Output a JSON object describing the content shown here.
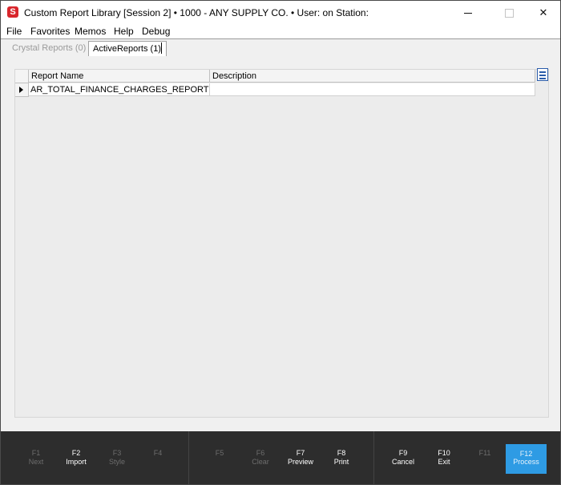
{
  "window": {
    "icon_letter": "S",
    "title": "Custom Report Library [Session 2]  •  1000 - ANY SUPPLY CO.  •  User:              on Station:"
  },
  "menu": [
    "File",
    "Favorites",
    "Memos",
    "Help",
    "Debug"
  ],
  "tabs": [
    {
      "label": "Crystal Reports (0)",
      "active": false
    },
    {
      "label": "ActiveReports (1)",
      "active": true
    }
  ],
  "grid": {
    "columns": [
      "Report Name",
      "Description"
    ],
    "rows": [
      {
        "name": "AR_TOTAL_FINANCE_CHARGES_REPORT",
        "description": ""
      }
    ]
  },
  "function_keys": [
    {
      "key": "F1",
      "label": "Next",
      "enabled": false
    },
    {
      "key": "F2",
      "label": "Import",
      "enabled": true
    },
    {
      "key": "F3",
      "label": "Style",
      "enabled": false
    },
    {
      "key": "F4",
      "label": "",
      "enabled": false
    },
    {
      "key": "F5",
      "label": "",
      "enabled": false
    },
    {
      "key": "F6",
      "label": "Clear",
      "enabled": false
    },
    {
      "key": "F7",
      "label": "Preview",
      "enabled": true
    },
    {
      "key": "F8",
      "label": "Print",
      "enabled": true
    },
    {
      "key": "F9",
      "label": "Cancel",
      "enabled": true
    },
    {
      "key": "F10",
      "label": "Exit",
      "enabled": true
    },
    {
      "key": "F11",
      "label": "",
      "enabled": false
    },
    {
      "key": "F12",
      "label": "Process",
      "enabled": true,
      "primary": true
    }
  ],
  "colors": {
    "accent": "#2e9be4",
    "fbar_bg": "#2d2d2d",
    "app_icon": "#d9262c"
  }
}
